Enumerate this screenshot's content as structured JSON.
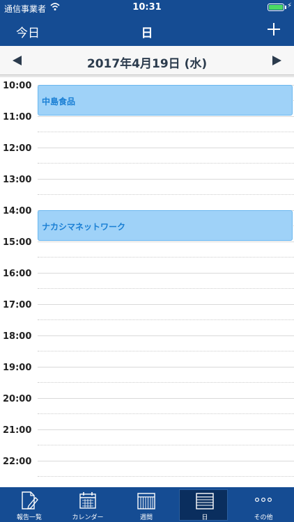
{
  "status_bar": {
    "carrier": "通信事業者",
    "time": "10:31"
  },
  "nav": {
    "today_label": "今日",
    "title": "日"
  },
  "date_header": {
    "date": "2017年4月19日 (水)"
  },
  "timeline": {
    "hours": [
      "10:00",
      "11:00",
      "12:00",
      "13:00",
      "14:00",
      "15:00",
      "16:00",
      "17:00",
      "18:00",
      "19:00",
      "20:00",
      "21:00",
      "22:00"
    ],
    "events": [
      {
        "title": "中島食品",
        "start": "10:00",
        "end": "11:00"
      },
      {
        "title": "ナカシマネットワーク",
        "start": "14:00",
        "end": "15:00"
      }
    ]
  },
  "tabs": [
    {
      "label": "報告一覧",
      "icon": "report-edit-icon",
      "active": false
    },
    {
      "label": "カレンダー",
      "icon": "calendar-icon",
      "active": false
    },
    {
      "label": "週間",
      "icon": "week-grid-icon",
      "active": false
    },
    {
      "label": "日",
      "icon": "day-list-icon",
      "active": true
    },
    {
      "label": "その他",
      "icon": "more-dots-icon",
      "active": false
    }
  ],
  "colors": {
    "bar": "#154c93",
    "event_fill": "#9fd2f8",
    "event_text": "#1a7fd4",
    "battery": "#4cd964"
  }
}
